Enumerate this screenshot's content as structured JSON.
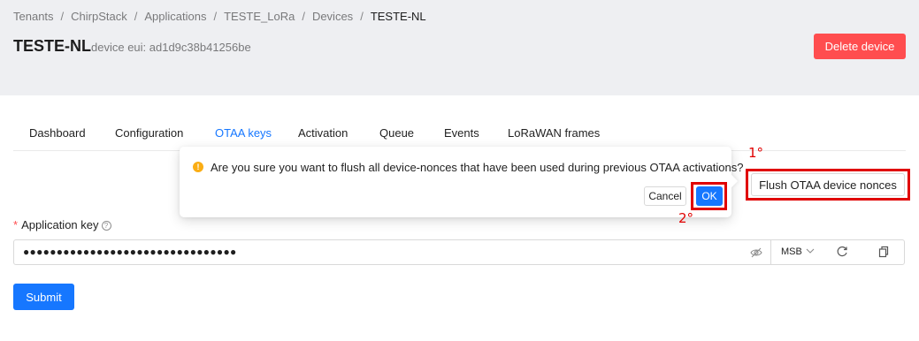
{
  "breadcrumb": {
    "items": [
      "Tenants",
      "ChirpStack",
      "Applications",
      "TESTE_LoRa",
      "Devices",
      "TESTE-NL"
    ],
    "separator": "/"
  },
  "header": {
    "title": "TESTE-NL",
    "subtitle": "device eui: ad1d9c38b41256be",
    "delete_label": "Delete device"
  },
  "tabs": [
    {
      "label": "Dashboard",
      "active": false
    },
    {
      "label": "Configuration",
      "active": false
    },
    {
      "label": "OTAA keys",
      "active": true
    },
    {
      "label": "Activation",
      "active": false
    },
    {
      "label": "Queue",
      "active": false
    },
    {
      "label": "Events",
      "active": false
    },
    {
      "label": "LoRaWAN frames",
      "active": false
    }
  ],
  "popconfirm": {
    "message": "Are you sure you want to flush all device-nonces that have been used during previous OTAA activations?",
    "cancel_label": "Cancel",
    "ok_label": "OK",
    "icon": "exclamation-circle-icon"
  },
  "flush_button_label": "Flush OTAA device nonces",
  "form": {
    "app_key_label": "Application key",
    "required_mark": "*",
    "help_glyph": "?",
    "app_key_value": "●●●●●●●●●●●●●●●●●●●●●●●●●●●●●●●●",
    "byte_order": "MSB",
    "submit_label": "Submit"
  },
  "annotations": {
    "step1": "1°",
    "step2": "2°"
  },
  "colors": {
    "accent": "#1677ff",
    "danger": "#ff4d4f",
    "warning": "#faad14",
    "annotation": "#e00000",
    "header_bg": "#eeeff2"
  }
}
